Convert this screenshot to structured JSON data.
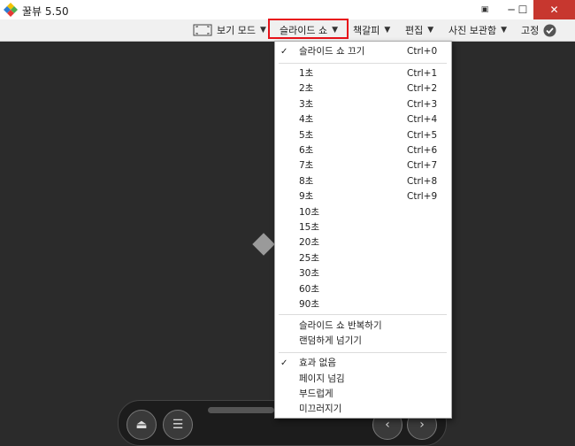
{
  "window": {
    "title": "꿀뷰 5.50",
    "minimize_icon": "minimize-icon",
    "maximize_icon": "maximize-icon",
    "close_icon": "close-icon"
  },
  "toolbar": {
    "view_mode_label": "보기 모드",
    "slideshow_label": "슬라이드 쇼",
    "bookmark_label": "책갈피",
    "edit_label": "편집",
    "album_label": "사진 보관함",
    "pin_label": "고정"
  },
  "colors": {
    "highlight": "#e8121a",
    "viewer_bg": "#2b2b2b"
  },
  "slideshow_menu": {
    "stop": {
      "label": "슬라이드 쇼 끄기",
      "shortcut": "Ctrl+0",
      "checked": true
    },
    "intervals": [
      {
        "label": "1초",
        "shortcut": "Ctrl+1"
      },
      {
        "label": "2초",
        "shortcut": "Ctrl+2"
      },
      {
        "label": "3초",
        "shortcut": "Ctrl+3"
      },
      {
        "label": "4초",
        "shortcut": "Ctrl+4"
      },
      {
        "label": "5초",
        "shortcut": "Ctrl+5"
      },
      {
        "label": "6초",
        "shortcut": "Ctrl+6"
      },
      {
        "label": "7초",
        "shortcut": "Ctrl+7"
      },
      {
        "label": "8초",
        "shortcut": "Ctrl+8"
      },
      {
        "label": "9초",
        "shortcut": "Ctrl+9"
      },
      {
        "label": "10초",
        "shortcut": ""
      },
      {
        "label": "15초",
        "shortcut": ""
      },
      {
        "label": "20초",
        "shortcut": ""
      },
      {
        "label": "25초",
        "shortcut": ""
      },
      {
        "label": "30초",
        "shortcut": ""
      },
      {
        "label": "60초",
        "shortcut": ""
      },
      {
        "label": "90초",
        "shortcut": ""
      }
    ],
    "repeat_label": "슬라이드 쇼 반복하기",
    "random_label": "랜덤하게 넘기기",
    "effects": [
      {
        "label": "효과 없음",
        "checked": true
      },
      {
        "label": "페이지 넘김",
        "checked": false
      },
      {
        "label": "부드럽게",
        "checked": false
      },
      {
        "label": "미끄러지기",
        "checked": false
      }
    ]
  }
}
